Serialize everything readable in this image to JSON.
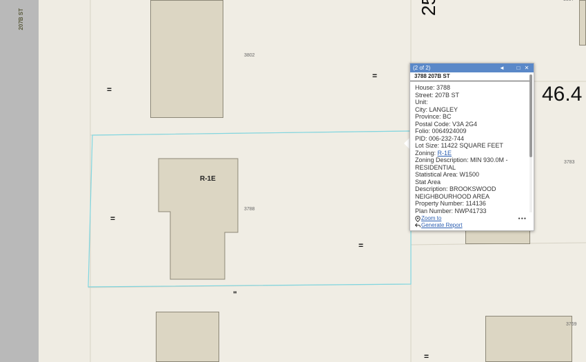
{
  "map": {
    "road_label": "207B ST",
    "big_digits_top": "25",
    "big_digits_right": "46.4",
    "zone_label": "R-1E",
    "addresses": {
      "a3802": "3802",
      "a3788": "3788",
      "a3783": "3783",
      "a3769": "3769",
      "a3807": "3807"
    },
    "tick_marks": {
      "single": "=",
      "double": "\""
    }
  },
  "popup": {
    "count": "(2 of 2)",
    "title": "3788 207B ST",
    "fields": {
      "house": "House: 3788",
      "street": "Street: 207B ST",
      "unit": "Unit:",
      "city": "City: LANGLEY",
      "province": "Province: BC",
      "postal": "Postal Code: V3A 2G4",
      "folio": "Folio: 0064924009",
      "pid": "PID: 006-232-744",
      "lot_size": "Lot Size: 11422 SQUARE FEET",
      "zoning_label": "Zoning: ",
      "zoning_link": "R-1E",
      "zoning_desc": "Zoning Description: MIN 930.0M - RESIDENTIAL",
      "stat_area": "Statistical Area: W1500",
      "stat_area2": "Stat Area",
      "description": "Description: BROOKSWOOD NEIGHBOURHOOD AREA",
      "property_number": "Property Number: 114136",
      "plan_number": "Plan Number: NWP41733"
    },
    "actions": {
      "zoom": "Zoom to",
      "report": "Generate Report",
      "more": "•••"
    },
    "icons": {
      "prev": "◄",
      "maximize": "□",
      "close": "✕",
      "zoom": "pin-icon",
      "report": "back-arrow-icon"
    }
  }
}
